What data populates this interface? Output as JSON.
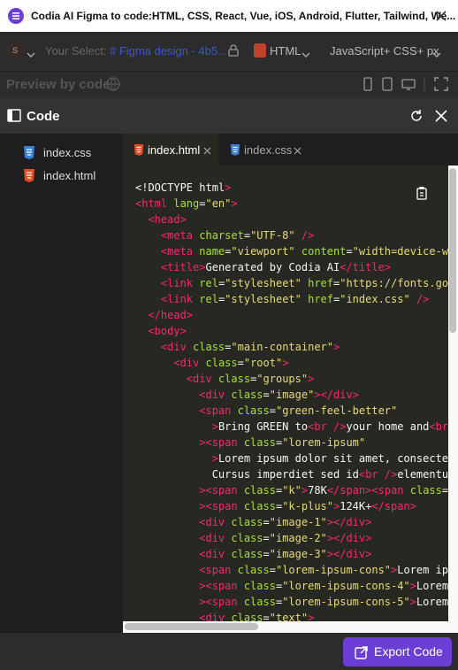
{
  "window": {
    "title": "Codia AI Figma to code:HTML, CSS, React, Vue, iOS, Android, Flutter, Tailwind, We..."
  },
  "toolbar": {
    "avatar_initial": "S",
    "your_select_label": "Your Select:",
    "figma_design": "# Figma design - 4b5...",
    "html_label": "HTML",
    "js_css_label": "JavaScript+ CSS+ px"
  },
  "preview": {
    "label": "Preview by code"
  },
  "code_panel": {
    "title": "Code"
  },
  "files": [
    {
      "name": "index.css",
      "icon": "css-file-icon"
    },
    {
      "name": "index.html",
      "icon": "html-file-icon"
    }
  ],
  "tabs": [
    {
      "label": "index.html",
      "active": true
    },
    {
      "label": "index.css",
      "active": false
    }
  ],
  "code_lines": [
    "<!DOCTYPE html>",
    "<html lang=\"en\">",
    "  <head>",
    "    <meta charset=\"UTF-8\" />",
    "    <meta name=\"viewport\" content=\"width=device-w",
    "    <title>Generated by Codia AI</title>",
    "    <link rel=\"stylesheet\" href=\"https://fonts.go",
    "    <link rel=\"stylesheet\" href=\"index.css\" />",
    "  </head>",
    "  <body>",
    "    <div class=\"main-container\">",
    "      <div class=\"root\">",
    "        <div class=\"groups\">",
    "          <div class=\"image\"></div>",
    "          <span class=\"green-feel-better\"",
    "            >Bring GREEN to<br />your home and<br",
    "          ><span class=\"lorem-ipsum\"",
    "            >Lorem ipsum dolor sit amet, consecte",
    "            Cursus imperdiet sed id<br />elementu",
    "          ><span class=\"k\">78K</span><span class=",
    "          ><span class=\"k-plus\">124K+</span>",
    "          <div class=\"image-1\"></div>",
    "          <div class=\"image-2\"></div>",
    "          <div class=\"image-3\"></div>",
    "          <span class=\"lorem-ipsum-cons\">Lorem ip",
    "          ><span class=\"lorem-ipsum-cons-4\">Lorem",
    "          ><span class=\"lorem-ipsum-cons-5\">Lorem",
    "          <div class=\"text\">"
  ],
  "footer": {
    "export_label": "Export Code"
  },
  "colors": {
    "accent": "#6b3fd6",
    "editor_bg": "#272822",
    "tag": "#f92672",
    "attr": "#a6e22e",
    "string": "#e6db74"
  }
}
